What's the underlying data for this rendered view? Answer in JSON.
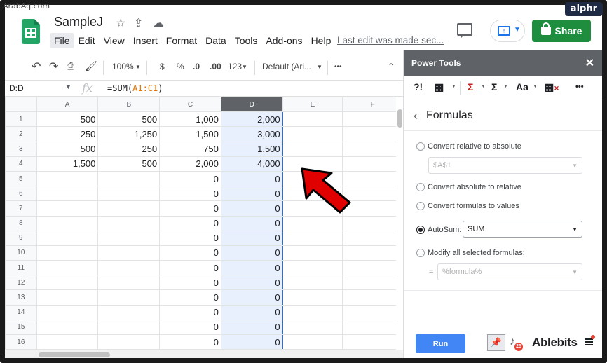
{
  "watermark": "ArabAq.com",
  "badge": "alphr",
  "doc": {
    "title": "SampleJ",
    "last_edit": "Last edit was made sec..."
  },
  "menu": [
    "File",
    "Edit",
    "View",
    "Insert",
    "Format",
    "Data",
    "Tools",
    "Add-ons",
    "Help"
  ],
  "share_label": "Share",
  "toolbar": {
    "zoom": "100%",
    "currency": "$",
    "percent": "%",
    "dec_decrease": ".0",
    "dec_increase": ".00",
    "format_more": "123",
    "font": "Default (Ari...",
    "more": "•••"
  },
  "formula_bar": {
    "name_box": "D:D",
    "fx": "fx",
    "formula_prefix": "=SUM(",
    "formula_ref": "A1:C1",
    "formula_suffix": ")"
  },
  "sheet": {
    "columns": [
      "A",
      "B",
      "C",
      "D",
      "E",
      "F"
    ],
    "selected_column": "D",
    "rows": [
      [
        "1",
        "500",
        "500",
        "1,000",
        "2,000"
      ],
      [
        "2",
        "250",
        "1,250",
        "1,500",
        "3,000"
      ],
      [
        "3",
        "500",
        "250",
        "750",
        "1,500"
      ],
      [
        "4",
        "1,500",
        "500",
        "2,000",
        "4,000"
      ],
      [
        "5",
        "",
        "",
        "0",
        "0"
      ],
      [
        "6",
        "",
        "",
        "0",
        "0"
      ],
      [
        "7",
        "",
        "",
        "0",
        "0"
      ],
      [
        "8",
        "",
        "",
        "0",
        "0"
      ],
      [
        "9",
        "",
        "",
        "0",
        "0"
      ],
      [
        "10",
        "",
        "",
        "0",
        "0"
      ],
      [
        "11",
        "",
        "",
        "0",
        "0"
      ],
      [
        "12",
        "",
        "",
        "0",
        "0"
      ],
      [
        "13",
        "",
        "",
        "0",
        "0"
      ],
      [
        "14",
        "",
        "",
        "0",
        "0"
      ],
      [
        "15",
        "",
        "",
        "0",
        "0"
      ],
      [
        "16",
        "",
        "",
        "0",
        "0"
      ]
    ]
  },
  "panel": {
    "header": "Power Tools",
    "close": "✕",
    "section_title": "Formulas",
    "options": {
      "rel_to_abs": "Convert relative to absolute",
      "rel_to_abs_value": "$A$1",
      "abs_to_rel": "Convert absolute to relative",
      "to_values": "Convert formulas to values",
      "autosum": "AutoSum:",
      "autosum_value": "SUM",
      "modify": "Modify all selected formulas:",
      "modify_eq": "=",
      "modify_value": "%formula%"
    },
    "run_label": "Run",
    "brand": "Ablebits",
    "badge_count": "25"
  }
}
